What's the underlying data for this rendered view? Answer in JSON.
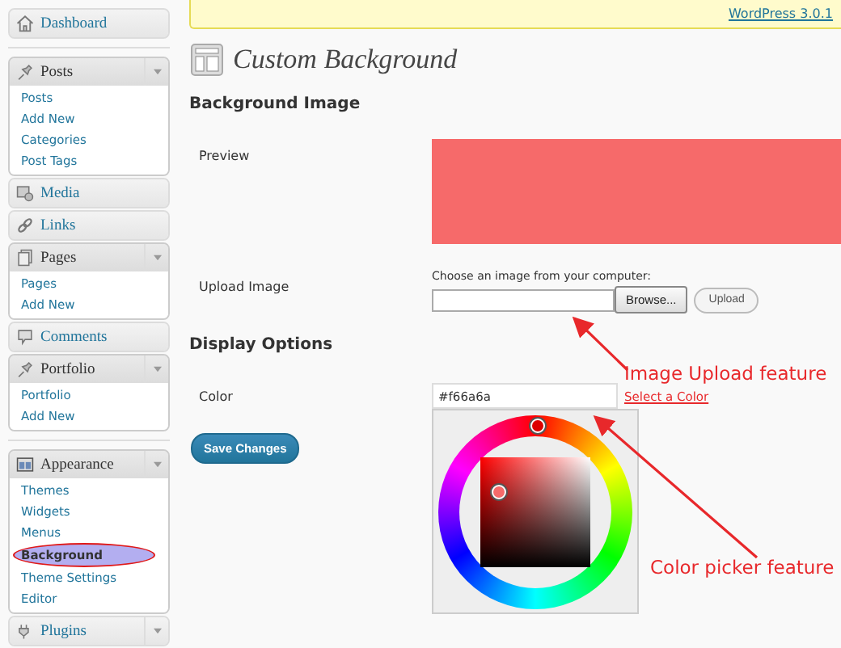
{
  "update_notice": {
    "link": "WordPress 3.0.1"
  },
  "sidebar": {
    "groups": [
      [
        {
          "label": "Dashboard",
          "has_submenu": false,
          "expanded": false
        }
      ],
      [
        {
          "label": "Posts",
          "has_submenu": true,
          "expanded": true,
          "children": [
            {
              "label": "Posts",
              "selected": false
            },
            {
              "label": "Add New",
              "selected": false
            },
            {
              "label": "Categories",
              "selected": false
            },
            {
              "label": "Post Tags",
              "selected": false
            }
          ]
        },
        {
          "label": "Media",
          "has_submenu": false,
          "expanded": false
        },
        {
          "label": "Links",
          "has_submenu": false,
          "expanded": false
        },
        {
          "label": "Pages",
          "has_submenu": true,
          "expanded": true,
          "children": [
            {
              "label": "Pages",
              "selected": false
            },
            {
              "label": "Add New",
              "selected": false
            }
          ]
        },
        {
          "label": "Comments",
          "has_submenu": false,
          "expanded": false
        },
        {
          "label": "Portfolio",
          "has_submenu": true,
          "expanded": true,
          "children": [
            {
              "label": "Portfolio",
              "selected": false
            },
            {
              "label": "Add New",
              "selected": false
            }
          ]
        }
      ],
      [
        {
          "label": "Appearance",
          "has_submenu": true,
          "expanded": true,
          "children": [
            {
              "label": "Themes",
              "selected": false
            },
            {
              "label": "Widgets",
              "selected": false
            },
            {
              "label": "Menus",
              "selected": false
            },
            {
              "label": "Background",
              "selected": true
            },
            {
              "label": "Theme Settings",
              "selected": false
            },
            {
              "label": "Editor",
              "selected": false
            }
          ]
        },
        {
          "label": "Plugins",
          "has_submenu": true,
          "expanded": false
        }
      ]
    ]
  },
  "page": {
    "title": "Custom Background",
    "background_image": {
      "heading": "Background Image",
      "preview_label": "Preview",
      "upload_label": "Upload Image",
      "upload_hint": "Choose an image from your computer:",
      "browse_button": "Browse...",
      "upload_button": "Upload"
    },
    "display_options": {
      "heading": "Display Options",
      "color_label": "Color",
      "color_value": "#f66a6a",
      "select_link": "Select a Color"
    },
    "save_button": "Save Changes"
  },
  "annotations": [
    {
      "text": "Image Upload feature"
    },
    {
      "text": "Color picker feature"
    }
  ]
}
